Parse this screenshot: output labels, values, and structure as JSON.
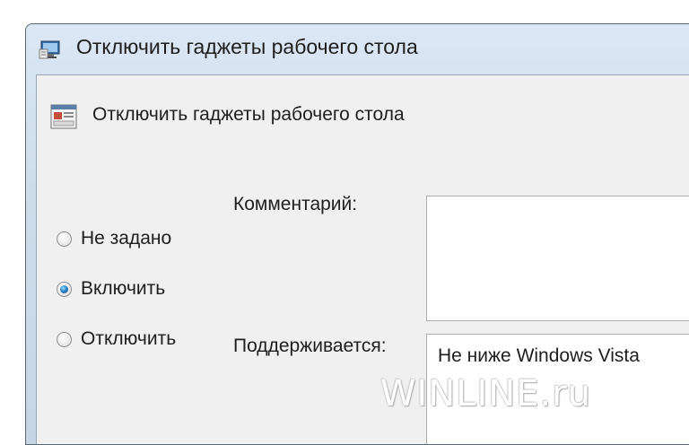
{
  "window": {
    "title": "Отключить гаджеты рабочего стола",
    "title_icon": "policy-settings-icon"
  },
  "policy": {
    "name": "Отключить гаджеты рабочего стола",
    "icon": "policy-setting-icon"
  },
  "state_options": [
    {
      "label": "Не задано",
      "checked": false
    },
    {
      "label": "Включить",
      "checked": true
    },
    {
      "label": "Отключить",
      "checked": false
    }
  ],
  "comment": {
    "label": "Комментарий:",
    "value": ""
  },
  "supported": {
    "label": "Поддерживается:",
    "value": "Не ниже Windows Vista"
  },
  "watermark": "WINLINE.ru",
  "colors": {
    "title_glass": "#cfdcea",
    "client_bg": "#f0f0f0",
    "radio_selected": "#2b86c8"
  }
}
